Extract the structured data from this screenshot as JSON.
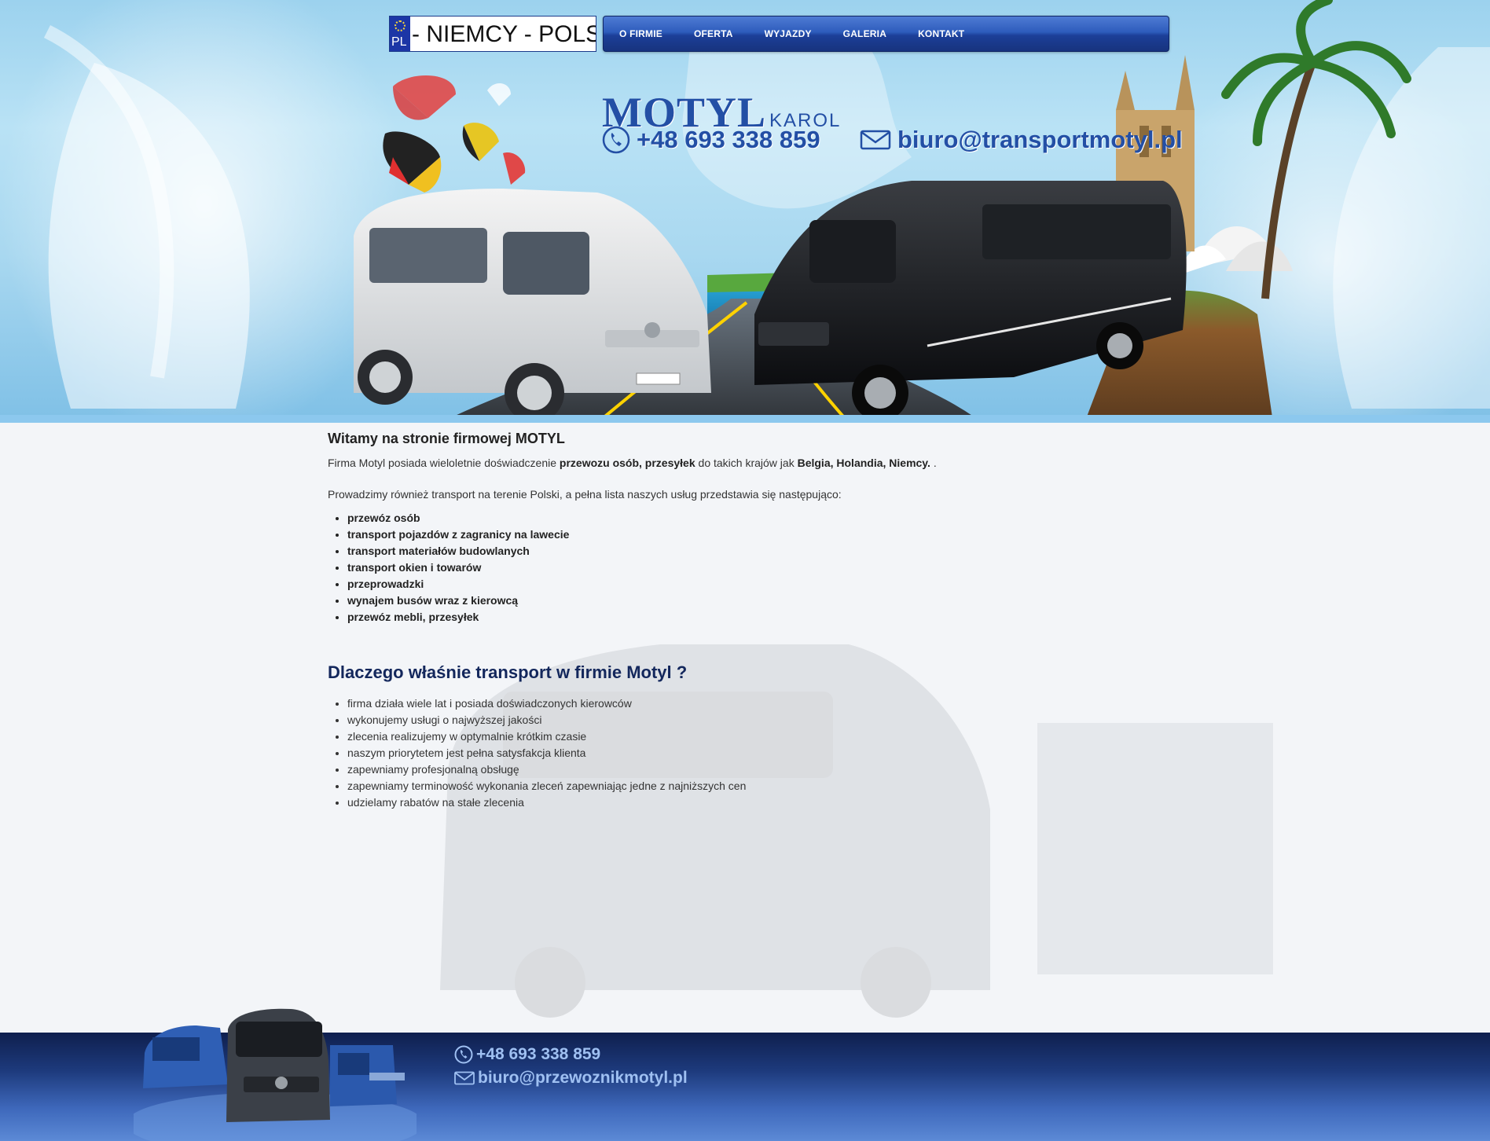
{
  "header": {
    "plate_code": "PL",
    "plate_text": "- NIEMCY - POLS",
    "brand_name": "MOTYL",
    "brand_sub": "KAROL",
    "phone": "+48 693 338 859",
    "email": "biuro@transportmotyl.pl"
  },
  "nav": {
    "items": [
      "O FIRMIE",
      "OFERTA",
      "WYJAZDY",
      "GALERIA",
      "KONTAKT"
    ]
  },
  "main": {
    "welcome_title": "Witamy na stronie firmowej MOTYL",
    "intro": {
      "part1": "Firma Motyl posiada wieloletnie doświadczenie ",
      "bold1": "przewozu osób, przesyłek",
      "part2": " do takich krajów jak ",
      "bold2": "Belgia, Holandia, Niemcy.",
      "part3": " ."
    },
    "paragraph2": "Prowadzimy również transport na terenie Polski, a pełna lista naszych usług przedstawia się następująco:",
    "services": [
      "przewóz osób",
      "transport pojazdów z zagranicy na lawecie",
      "transport materiałów budowlanych",
      "transport okien i towarów",
      "przeprowadzki",
      "wynajem busów wraz z kierowcą",
      "przewóz mebli, przesyłek"
    ],
    "why_title": "Dlaczego właśnie transport w firmie Motyl ?",
    "reasons": [
      "firma działa wiele lat i posiada doświadczonych kierowców",
      "wykonujemy usługi o najwyższej jakości",
      "zlecenia realizujemy w optymalnie krótkim czasie",
      "naszym priorytetem jest pełna satysfakcja klienta",
      "zapewniamy profesjonalną obsługę",
      "zapewniamy terminowość wykonania zleceń zapewniając jedne z najniższych cen",
      "udzielamy rabatów na stałe zlecenia"
    ]
  },
  "footer": {
    "phone": "+48 693 338 859",
    "email": "biuro@przewoznikmotyl.pl"
  },
  "colors": {
    "nav_blue": "#1c3f98",
    "brand_blue": "#234fa5",
    "footer_navy": "#0f1f4e",
    "why_title": "#13275c"
  }
}
